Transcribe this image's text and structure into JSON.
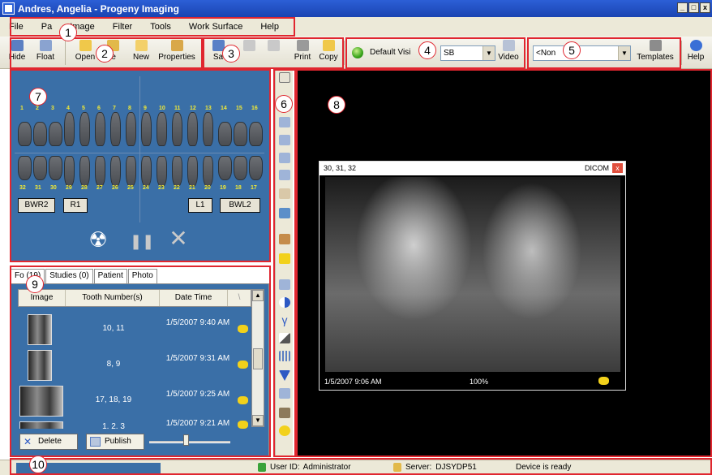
{
  "window": {
    "title": "Andres, Angelia - Progeny Imaging",
    "controls": [
      "_",
      "□",
      "x"
    ]
  },
  "menu": [
    "File",
    "Pa",
    "Image",
    "Filter",
    "Tools",
    "Work Surface",
    "Help"
  ],
  "toolbar": {
    "hide": "Hide",
    "float": "Float",
    "open": "Open",
    "close": "le",
    "new": "New",
    "properties": "Properties",
    "save": "Sa",
    "redo": "",
    "undo": "",
    "print": "Print",
    "copy": "Copy",
    "vision_combo": "Default Visi",
    "device_combo": "SB",
    "video": "Video",
    "template_combo": "<Non",
    "templates": "Templates",
    "help": "Help"
  },
  "callouts": [
    "1",
    "2",
    "3",
    "4",
    "5",
    "6",
    "7",
    "8",
    "9",
    "10"
  ],
  "chart": {
    "upper_numbers": [
      "1",
      "2",
      "3",
      "4",
      "5",
      "6",
      "7",
      "8",
      "9",
      "10",
      "11",
      "12",
      "13",
      "14",
      "15",
      "16"
    ],
    "lower_numbers": [
      "32",
      "31",
      "30",
      "29",
      "28",
      "27",
      "26",
      "25",
      "24",
      "23",
      "22",
      "21",
      "20",
      "19",
      "18",
      "17"
    ],
    "buttons": {
      "bwr2": "BWR2",
      "r1": "R1",
      "l1": "L1",
      "bwl2": "BWL2"
    },
    "controls": {
      "radiation": "☢",
      "pause": "❚❚",
      "cancel": "✕"
    }
  },
  "tabs": [
    "Fo  (19)",
    "Studies (0)",
    "Patient",
    "Photo"
  ],
  "list": {
    "headers": {
      "image": "Image",
      "teeth": "Tooth Number(s)",
      "date": "Date Time",
      "sort": "\\"
    },
    "rows": [
      {
        "teeth": "10, 11",
        "date": "1/5/2007 9:40 AM"
      },
      {
        "teeth": "8, 9",
        "date": "1/5/2007 9:31 AM"
      },
      {
        "teeth": "17, 18, 19",
        "date": "1/5/2007 9:25 AM"
      },
      {
        "teeth": "1, 2, 3",
        "date": "1/5/2007 9:21 AM"
      }
    ],
    "slider_level": 0.42
  },
  "actions": {
    "delete": "Delete",
    "publish": "Publish"
  },
  "xray": {
    "teeth": "30, 31, 32",
    "format": "DICOM",
    "timestamp": "1/5/2007 9:06 AM",
    "zoom": "100%",
    "close": "x"
  },
  "status": {
    "user_label": "User ID:",
    "user": "Administrator",
    "server_label": "Server:",
    "server": "DJSYDP51",
    "device": "Device is ready"
  },
  "colors": {
    "panel_blue": "#3a6fa7",
    "accent_red": "#e0262f",
    "tooth_label": "#f2ea35"
  }
}
